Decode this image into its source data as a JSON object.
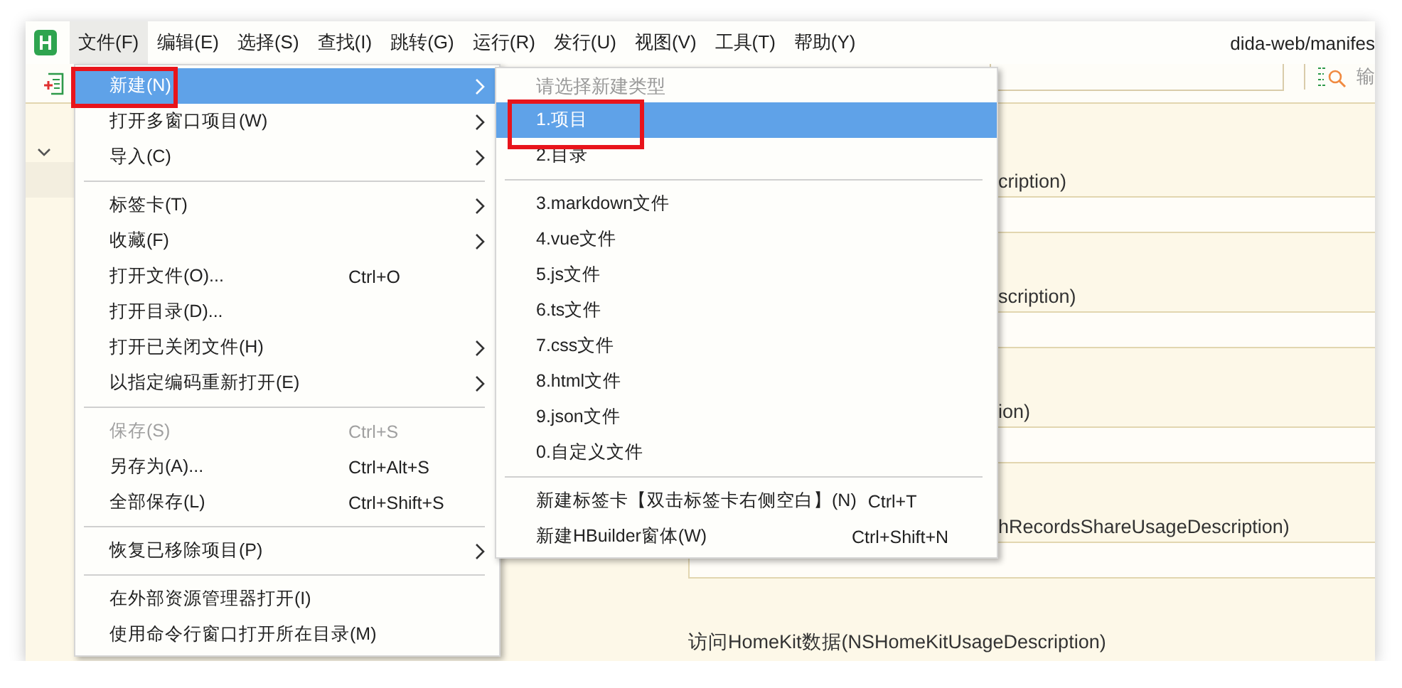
{
  "app": {
    "title": "dida-web/manifes"
  },
  "menubar": [
    {
      "label": "文件(F)",
      "selected": true
    },
    {
      "label": "编辑(E)",
      "selected": false
    },
    {
      "label": "选择(S)",
      "selected": false
    },
    {
      "label": "查找(I)",
      "selected": false
    },
    {
      "label": "跳转(G)",
      "selected": false
    },
    {
      "label": "运行(R)",
      "selected": false
    },
    {
      "label": "发行(U)",
      "selected": false
    },
    {
      "label": "视图(V)",
      "selected": false
    },
    {
      "label": "工具(T)",
      "selected": false
    },
    {
      "label": "帮助(Y)",
      "selected": false
    }
  ],
  "toolbar": {
    "search_placeholder": "输"
  },
  "file_menu": [
    {
      "kind": "item",
      "label": "新建(N)",
      "submenu": true,
      "selected": true,
      "disabled": false
    },
    {
      "kind": "item",
      "label": "打开多窗口项目(W)",
      "submenu": true,
      "selected": false,
      "disabled": false
    },
    {
      "kind": "item",
      "label": "导入(C)",
      "submenu": true,
      "selected": false,
      "disabled": false
    },
    {
      "kind": "separator"
    },
    {
      "kind": "item",
      "label": "标签卡(T)",
      "submenu": true,
      "selected": false,
      "disabled": false
    },
    {
      "kind": "item",
      "label": "收藏(F)",
      "submenu": true,
      "selected": false,
      "disabled": false
    },
    {
      "kind": "item",
      "label": "打开文件(O)...",
      "shortcut": "Ctrl+O",
      "submenu": false,
      "selected": false,
      "disabled": false
    },
    {
      "kind": "item",
      "label": "打开目录(D)...",
      "submenu": false,
      "selected": false,
      "disabled": false
    },
    {
      "kind": "item",
      "label": "打开已关闭文件(H)",
      "submenu": true,
      "selected": false,
      "disabled": false
    },
    {
      "kind": "item",
      "label": "以指定编码重新打开(E)",
      "submenu": true,
      "selected": false,
      "disabled": false
    },
    {
      "kind": "separator"
    },
    {
      "kind": "item",
      "label": "保存(S)",
      "shortcut": "Ctrl+S",
      "submenu": false,
      "selected": false,
      "disabled": true
    },
    {
      "kind": "item",
      "label": "另存为(A)...",
      "shortcut": "Ctrl+Alt+S",
      "submenu": false,
      "selected": false,
      "disabled": false
    },
    {
      "kind": "item",
      "label": "全部保存(L)",
      "shortcut": "Ctrl+Shift+S",
      "submenu": false,
      "selected": false,
      "disabled": false
    },
    {
      "kind": "separator"
    },
    {
      "kind": "item",
      "label": "恢复已移除项目(P)",
      "submenu": true,
      "selected": false,
      "disabled": false
    },
    {
      "kind": "separator"
    },
    {
      "kind": "item",
      "label": "在外部资源管理器打开(I)",
      "submenu": false,
      "selected": false,
      "disabled": false
    },
    {
      "kind": "item",
      "label": "使用命令行窗口打开所在目录(M)",
      "submenu": false,
      "selected": false,
      "disabled": false
    }
  ],
  "new_submenu": [
    {
      "kind": "header",
      "label": "请选择新建类型"
    },
    {
      "kind": "item",
      "label": "1.项目",
      "selected": true
    },
    {
      "kind": "item",
      "label": "2.目录",
      "selected": false
    },
    {
      "kind": "separator"
    },
    {
      "kind": "item",
      "label": "3.markdown文件",
      "selected": false
    },
    {
      "kind": "item",
      "label": "4.vue文件",
      "selected": false
    },
    {
      "kind": "item",
      "label": "5.js文件",
      "selected": false
    },
    {
      "kind": "item",
      "label": "6.ts文件",
      "selected": false
    },
    {
      "kind": "item",
      "label": "7.css文件",
      "selected": false
    },
    {
      "kind": "item",
      "label": "8.html文件",
      "selected": false
    },
    {
      "kind": "item",
      "label": "9.json文件",
      "selected": false
    },
    {
      "kind": "item",
      "label": "0.自定义文件",
      "selected": false
    },
    {
      "kind": "separator"
    },
    {
      "kind": "item",
      "label": "新建标签卡【双击标签卡右侧空白】(N)",
      "shortcut": "Ctrl+T",
      "selected": false
    },
    {
      "kind": "item",
      "label": "新建HBuilder窗体(W)",
      "shortcut": "Ctrl+Shift+N",
      "selected": false
    }
  ],
  "editor_sections": [
    {
      "kind": "clipped",
      "label": "cription)"
    },
    {
      "kind": "clipped",
      "label": "scription)"
    },
    {
      "kind": "clipped",
      "label": "ion)"
    },
    {
      "kind": "clipped",
      "label": "hRecordsShareUsageDescription)"
    },
    {
      "kind": "full",
      "label": "访问HomeKit数据(NSHomeKitUsageDescription)"
    }
  ]
}
